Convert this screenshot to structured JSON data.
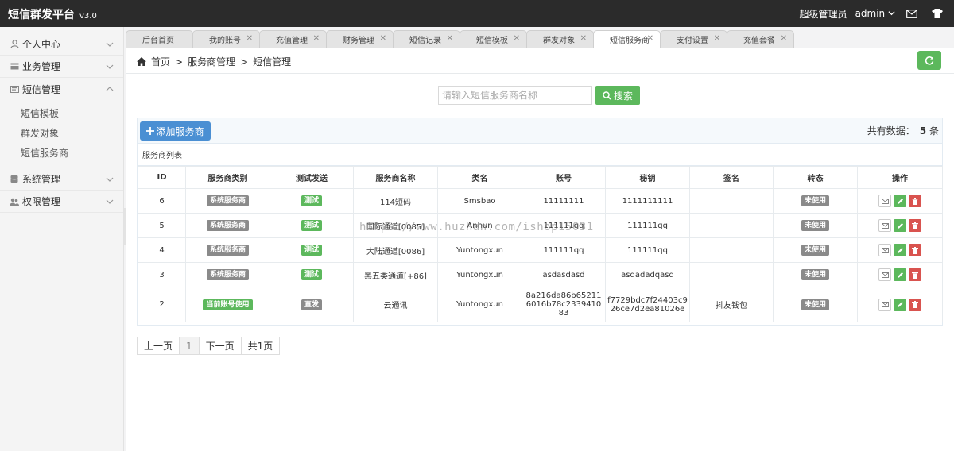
{
  "header": {
    "brand": "短信群发平台",
    "version": "v3.0",
    "role": "超级管理员",
    "user": "admin"
  },
  "sidebar": {
    "items": [
      {
        "label": "个人中心",
        "icon": "user-icon"
      },
      {
        "label": "业务管理",
        "icon": "card-icon"
      },
      {
        "label": "短信管理",
        "icon": "sms-icon",
        "expanded": true,
        "children": [
          "短信模板",
          "群发对象",
          "短信服务商"
        ]
      },
      {
        "label": "系统管理",
        "icon": "database-icon"
      },
      {
        "label": "权限管理",
        "icon": "users-icon"
      }
    ]
  },
  "tabs": [
    {
      "label": "后台首页",
      "closable": false
    },
    {
      "label": "我的账号",
      "closable": true
    },
    {
      "label": "充值管理",
      "closable": true
    },
    {
      "label": "财务管理",
      "closable": true
    },
    {
      "label": "短信记录",
      "closable": true
    },
    {
      "label": "短信模板",
      "closable": true
    },
    {
      "label": "群发对象",
      "closable": true
    },
    {
      "label": "短信服务商",
      "closable": true,
      "active": true
    },
    {
      "label": "支付设置",
      "closable": true
    },
    {
      "label": "充值套餐",
      "closable": true
    }
  ],
  "breadcrumb": [
    "首页",
    "服务商管理",
    "短信管理"
  ],
  "search": {
    "placeholder": "请输入短信服务商名称",
    "button": "搜索"
  },
  "toolbar": {
    "add_label": "添加服务商",
    "total_label": "共有数据：",
    "total_count": "5",
    "total_unit": "条"
  },
  "list_title": "服务商列表",
  "table": {
    "columns": [
      "ID",
      "服务商类别",
      "测试发送",
      "服务商名称",
      "类名",
      "账号",
      "秘钥",
      "签名",
      "转态",
      "操作"
    ],
    "rows": [
      {
        "id": "6",
        "category": "系统服务商",
        "category_color": "grey",
        "test": "测试",
        "test_color": "green",
        "name": "114短码",
        "class": "Smsbao",
        "account": "11111111",
        "secret": "1111111111",
        "sign": "",
        "status": "未使用"
      },
      {
        "id": "5",
        "category": "系统服务商",
        "category_color": "grey",
        "test": "测试",
        "test_color": "green",
        "name": "国际通道[0085]",
        "class": "Anhun",
        "account": "111111qq",
        "secret": "111111qq",
        "sign": "",
        "status": "未使用"
      },
      {
        "id": "4",
        "category": "系统服务商",
        "category_color": "grey",
        "test": "测试",
        "test_color": "green",
        "name": "大陆通道[0086]",
        "class": "Yuntongxun",
        "account": "111111qq",
        "secret": "111111qq",
        "sign": "",
        "status": "未使用"
      },
      {
        "id": "3",
        "category": "系统服务商",
        "category_color": "grey",
        "test": "测试",
        "test_color": "green",
        "name": "黑五类通道[+86]",
        "class": "Yuntongxun",
        "account": "asdasdasd",
        "secret": "asdadadqasd",
        "sign": "",
        "status": "未使用"
      },
      {
        "id": "2",
        "category": "当前账号使用",
        "category_color": "green",
        "test": "直发",
        "test_color": "grey",
        "name": "云通讯",
        "class": "Yuntongxun",
        "account": "8a216da86b652116016b78c233941083",
        "secret": "f7729bdc7f24403c926ce7d2ea81026e",
        "sign": "抖友钱包",
        "status": "未使用"
      }
    ]
  },
  "pager": [
    "上一页",
    "1",
    "下一页",
    "共1页"
  ],
  "watermark": "https://www.huzhan.com/ishop15031",
  "colors": {
    "topbar": "#2b2b2b",
    "primary": "#4a8fd3",
    "success": "#5cb85c",
    "danger": "#d9534f",
    "label_grey": "#8a8a8a"
  }
}
